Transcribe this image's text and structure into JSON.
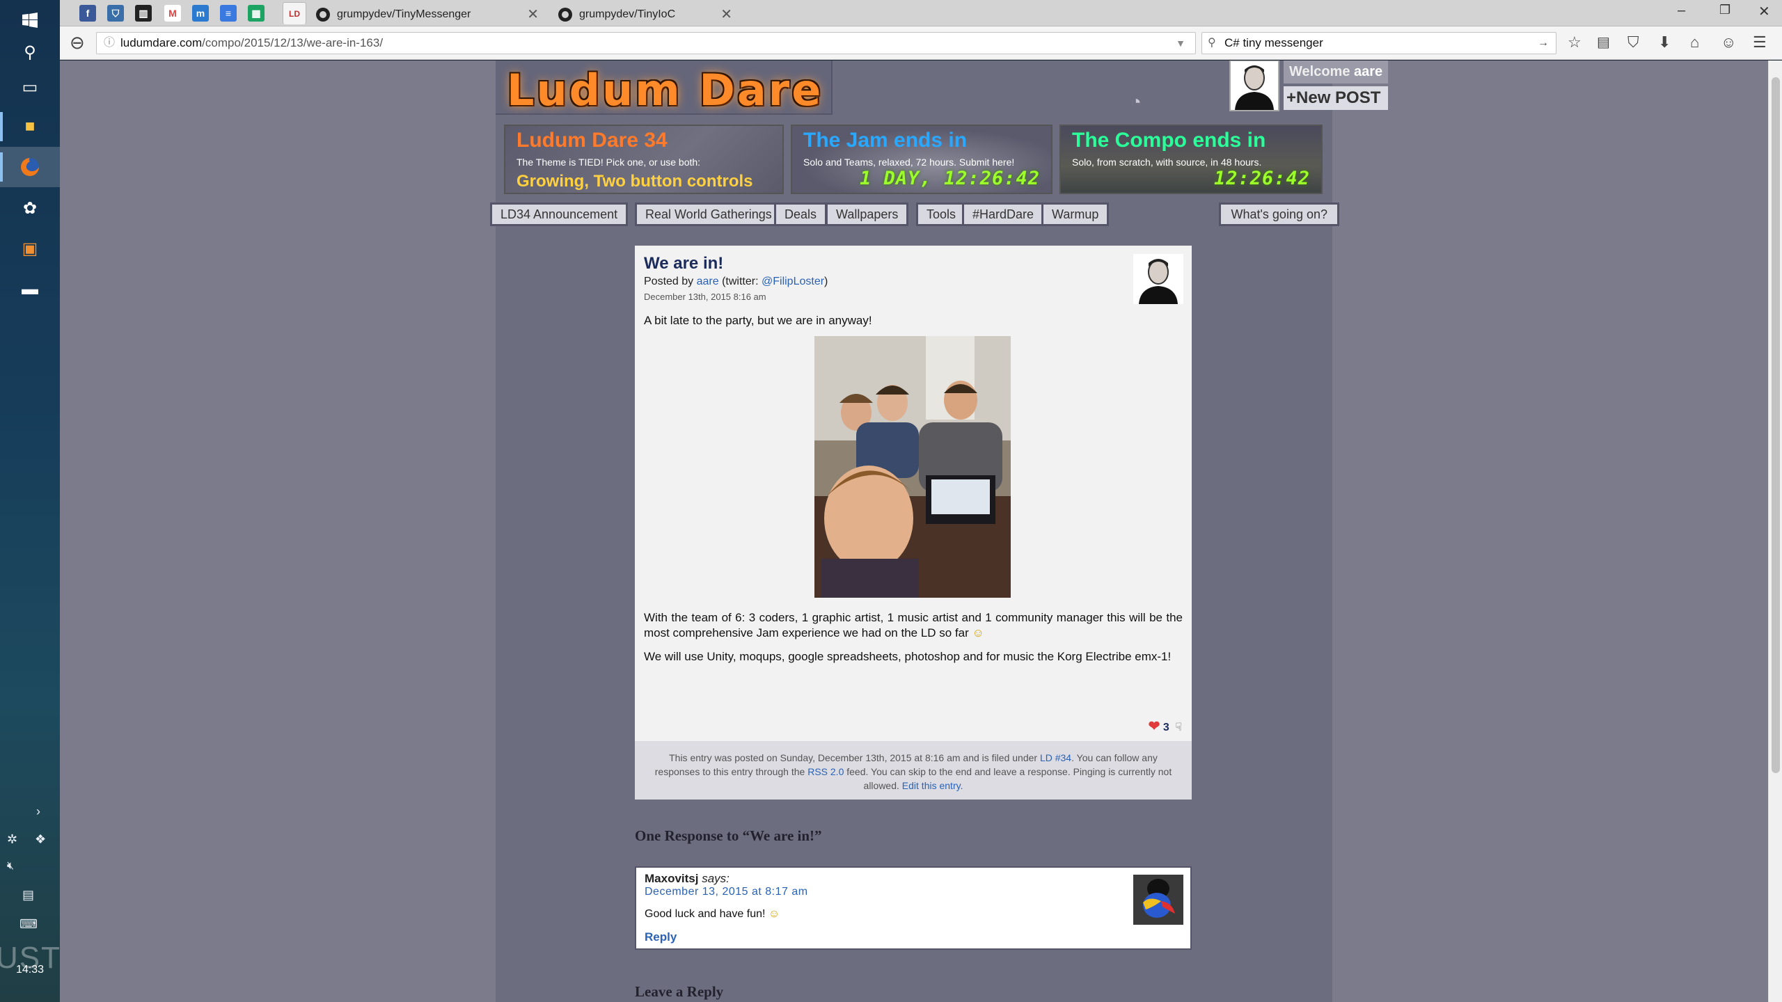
{
  "taskbar": {
    "clock": "14:33",
    "watermark": "UST"
  },
  "browser": {
    "tabs": [
      {
        "title": "grumpydev/TinyMessenger",
        "close": "✕"
      },
      {
        "title": "grumpydev/TinyIoC",
        "close": "✕"
      }
    ],
    "url_host": "ludumdare.com",
    "url_path": "/compo/2015/12/13/we-are-in-163/",
    "search_value": "C# tiny messenger"
  },
  "site": {
    "logo": "Ludum Dare",
    "welcome_prefix": "Welcome",
    "welcome_user": "aare",
    "new_post": "+New POST",
    "banners": [
      {
        "title": "Ludum Dare 34",
        "subtitle": "The Theme is TIED! Pick one, or use both:",
        "detail": "Growing, Two button controls",
        "countdown": ""
      },
      {
        "title": "The Jam ends in",
        "subtitle": "Solo and Teams, relaxed, 72 hours. Submit here!",
        "detail": "",
        "countdown": "1 DAY, 12:26:42"
      },
      {
        "title": "The Compo ends in",
        "subtitle": "Solo, from scratch, with source, in 48 hours.",
        "detail": "",
        "countdown": "12:26:42"
      }
    ],
    "menu": [
      "LD34 Announcement",
      "Real World Gatherings",
      "Deals",
      "Wallpapers",
      "Tools",
      "#HardDare",
      "Warmup"
    ],
    "menu_right": "What's going on?"
  },
  "post": {
    "title": "We are in!",
    "posted_by": "Posted by",
    "author": "aare",
    "twitter_prefix": "(twitter:",
    "twitter": "@FilipLoster",
    "twitter_suffix": ")",
    "date": "December 13th, 2015 8:16 am",
    "intro": "A bit late to the party, but we are in anyway!",
    "p1": "With the team of 6: 3 coders, 1 graphic artist, 1 music artist and 1 community manager this will be the most comprehensive Jam experience we had on the LD so far",
    "p2": "We will use Unity, moqups, google spreadsheets, photoshop and for music the Korg Electribe emx-1!",
    "likes": "3",
    "footer_1": "This entry was posted on Sunday, December 13th, 2015 at 8:16 am and is filed under",
    "footer_ld": "LD #34",
    "footer_2": ". You can follow any responses to this entry through the",
    "footer_rss": "RSS 2.0",
    "footer_3": "feed. You can skip to the end and leave a response. Pinging is currently not allowed.",
    "footer_edit": "Edit this entry."
  },
  "comments": {
    "heading": "One Response to “We are in!”",
    "items": [
      {
        "author": "Maxovitsj",
        "says": "says:",
        "date": "December 13, 2015 at 8:17 am",
        "text": "Good luck and have fun!",
        "reply": "Reply"
      }
    ]
  },
  "leave_reply": "Leave a Reply"
}
